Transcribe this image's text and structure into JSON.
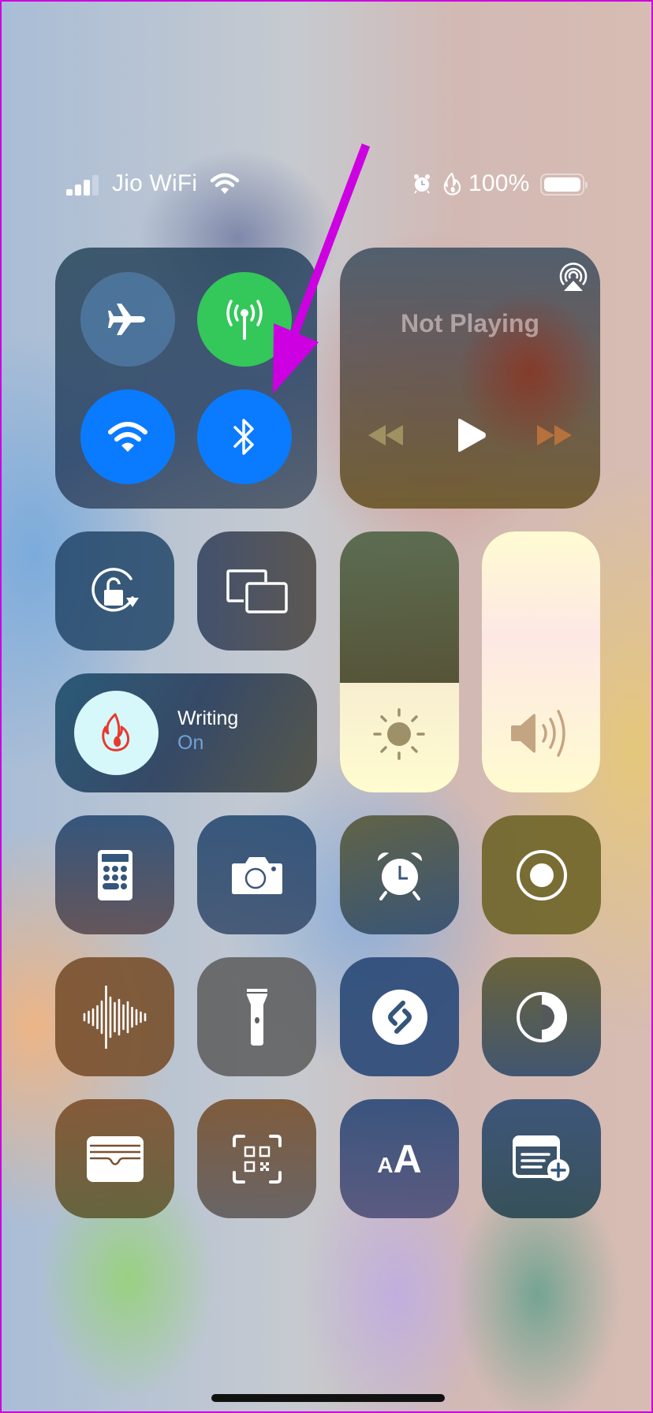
{
  "status_bar": {
    "carrier": "Jio WiFi",
    "signal_bars_filled": 3,
    "signal_bars_total": 4,
    "wifi_icon": "wifi-icon",
    "alarm_icon": "alarm-icon",
    "focus_icon": "flame-icon",
    "battery_percent_label": "100%",
    "battery_level": 1.0
  },
  "connectivity": {
    "airplane_mode": {
      "label": "Airplane Mode",
      "icon": "airplane-icon",
      "on": false
    },
    "cellular_data": {
      "label": "Cellular Data",
      "icon": "antenna-icon",
      "on": true,
      "color": "#34c759"
    },
    "wifi": {
      "label": "Wi-Fi",
      "icon": "wifi-icon",
      "on": true,
      "color": "#0a7bff"
    },
    "bluetooth": {
      "label": "Bluetooth",
      "icon": "bluetooth-icon",
      "on": true,
      "color": "#0a7bff"
    }
  },
  "media": {
    "title": "Not Playing",
    "airplay_icon": "airplay-icon",
    "controls": [
      "rewind-icon",
      "play-icon",
      "fast-forward-icon"
    ]
  },
  "controls": {
    "orientation_lock": {
      "label": "Orientation Lock",
      "icon": "orientation-lock-icon"
    },
    "screen_mirroring": {
      "label": "Screen Mirroring",
      "icon": "screen-mirroring-icon"
    },
    "focus": {
      "name": "Writing",
      "state": "On",
      "icon": "flame-icon",
      "accent": "#e8392f",
      "state_color": "#6fa3d8"
    },
    "brightness": {
      "label": "Brightness",
      "icon": "sun-icon",
      "level": 0.42
    },
    "volume": {
      "label": "Volume",
      "icon": "speaker-icon",
      "level": 1.0
    }
  },
  "shortcut_tiles": [
    {
      "label": "Calculator",
      "icon": "calculator-icon"
    },
    {
      "label": "Camera",
      "icon": "camera-icon"
    },
    {
      "label": "Alarm",
      "icon": "alarm-clock-icon"
    },
    {
      "label": "Screen Recording",
      "icon": "screen-record-icon"
    },
    {
      "label": "Voice Memos",
      "icon": "waveform-icon"
    },
    {
      "label": "Flashlight",
      "icon": "flashlight-icon"
    },
    {
      "label": "Shazam",
      "icon": "shazam-icon"
    },
    {
      "label": "Dark Mode",
      "icon": "dark-mode-icon"
    },
    {
      "label": "Wallet",
      "icon": "wallet-icon"
    },
    {
      "label": "Code Scanner",
      "icon": "qr-scanner-icon"
    },
    {
      "label": "Text Size",
      "icon": "text-size-icon",
      "glyph_small": "A",
      "glyph_large": "A"
    },
    {
      "label": "Quick Note",
      "icon": "quick-note-icon"
    }
  ],
  "annotation": {
    "type": "arrow",
    "color": "#cc00e0",
    "points_to": "bluetooth"
  }
}
